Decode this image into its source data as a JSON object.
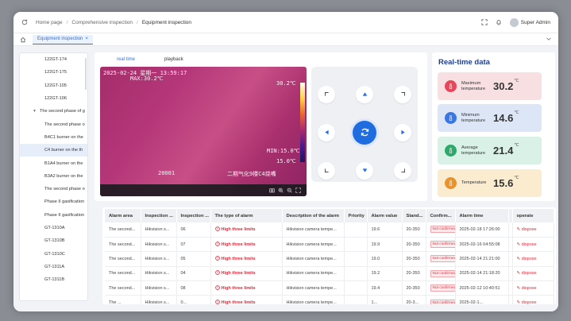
{
  "breadcrumb": [
    "Home page",
    "Comprehensive inspection",
    "Equipment inspection"
  ],
  "user": {
    "name": "Super Admin"
  },
  "tabs": [
    {
      "label": "Equipment inspection"
    }
  ],
  "sidebar": {
    "items": [
      {
        "label": "122GT-174",
        "type": "leaf"
      },
      {
        "label": "122GT-175",
        "type": "leaf"
      },
      {
        "label": "122GT-105",
        "type": "leaf"
      },
      {
        "label": "122GT-106",
        "type": "leaf"
      },
      {
        "label": "The second phase of g",
        "type": "parent"
      },
      {
        "label": "The second phase o",
        "type": "leaf"
      },
      {
        "label": "B4C1 burner on the",
        "type": "leaf"
      },
      {
        "label": "C4 burner on the th",
        "type": "leaf",
        "selected": true
      },
      {
        "label": "B1A4 burner on the",
        "type": "leaf"
      },
      {
        "label": "B3A2 burner on the",
        "type": "leaf"
      },
      {
        "label": "The second phase o",
        "type": "leaf"
      },
      {
        "label": "Phase II gasification",
        "type": "leaf"
      },
      {
        "label": "Phase II gasification",
        "type": "leaf"
      },
      {
        "label": "GT-1310A",
        "type": "leaf"
      },
      {
        "label": "GT-1310B",
        "type": "leaf"
      },
      {
        "label": "GT-1310C",
        "type": "leaf"
      },
      {
        "label": "GT-1311A",
        "type": "leaf"
      },
      {
        "label": "GT-1311B",
        "type": "leaf"
      }
    ]
  },
  "video": {
    "tabs": [
      "real time",
      "playback"
    ],
    "timestamp": "2025-02-24 星期一 13:59:17",
    "max_label": "MAX:30.2℃",
    "scale_high": "30.2℃",
    "scale_low": "15.0℃",
    "min_label": "MIN:15.0℃",
    "code": "20001",
    "caption": "二期气化9楼C4烧嘴"
  },
  "realtime": {
    "title": "Real-time data",
    "cards": [
      {
        "label": "Maximum temperature",
        "value": "30.2",
        "unit": "℃",
        "bg": "#f8dfe2",
        "iconColor": "#e8455a"
      },
      {
        "label": "Minimum temperature",
        "value": "14.6",
        "unit": "℃",
        "bg": "#dce6f7",
        "iconColor": "#3a76e6"
      },
      {
        "label": "Average temperature",
        "value": "21.4",
        "unit": "℃",
        "bg": "#d9f1e6",
        "iconColor": "#2fa86b"
      },
      {
        "label": "Temperature",
        "value": "15.6",
        "unit": "℃",
        "bg": "#fbeccf",
        "iconColor": "#e8922d"
      }
    ]
  },
  "table": {
    "headers": [
      "Alarm area",
      "Inspection ...",
      "Inspection ...",
      "The type of alarm",
      "Description of the alarm",
      "Priority",
      "Alarm value",
      "Stand...",
      "Confirm...",
      "Alarm time",
      "",
      "operate"
    ],
    "rows": [
      [
        "The second...",
        "Hikvision s...",
        "06",
        "High three limits",
        "Hikvision camera tempe...",
        "",
        "19.6",
        "20-350",
        "Not confirmed",
        "2025-02-18 17:26:00",
        "",
        "dispose"
      ],
      [
        "The second...",
        "Hikvision s...",
        "07",
        "High three limits",
        "Hikvision camera tempe...",
        "",
        "19.9",
        "20-350",
        "Not confirmed",
        "2025-02-16 04:55:08",
        "",
        "dispose"
      ],
      [
        "The second...",
        "Hikvision s...",
        "05",
        "High three limits",
        "Hikvision camera tempe...",
        "",
        "19.0",
        "20-350",
        "Not confirmed",
        "2025-02-14 21:21:00",
        "",
        "dispose"
      ],
      [
        "The second...",
        "Hikvision s...",
        "04",
        "High three limits",
        "Hikvision camera tempe...",
        "",
        "19.2",
        "20-350",
        "Not confirmed",
        "2025-02-14 21:18:20",
        "",
        "dispose"
      ],
      [
        "The second...",
        "Hikvision s...",
        "08",
        "High three limits",
        "Hikvision camera tempe...",
        "",
        "19.4",
        "20-350",
        "Not confirmed",
        "2025-02-12 10:40:51",
        "",
        "dispose"
      ],
      [
        "The ...",
        "Hikvision s...",
        "0...",
        "High three limits",
        "Hikvision camera tempe...",
        "",
        "1...",
        "20-3...",
        "Not confirmed",
        "2025-02-1...",
        "",
        "dispose"
      ]
    ]
  }
}
